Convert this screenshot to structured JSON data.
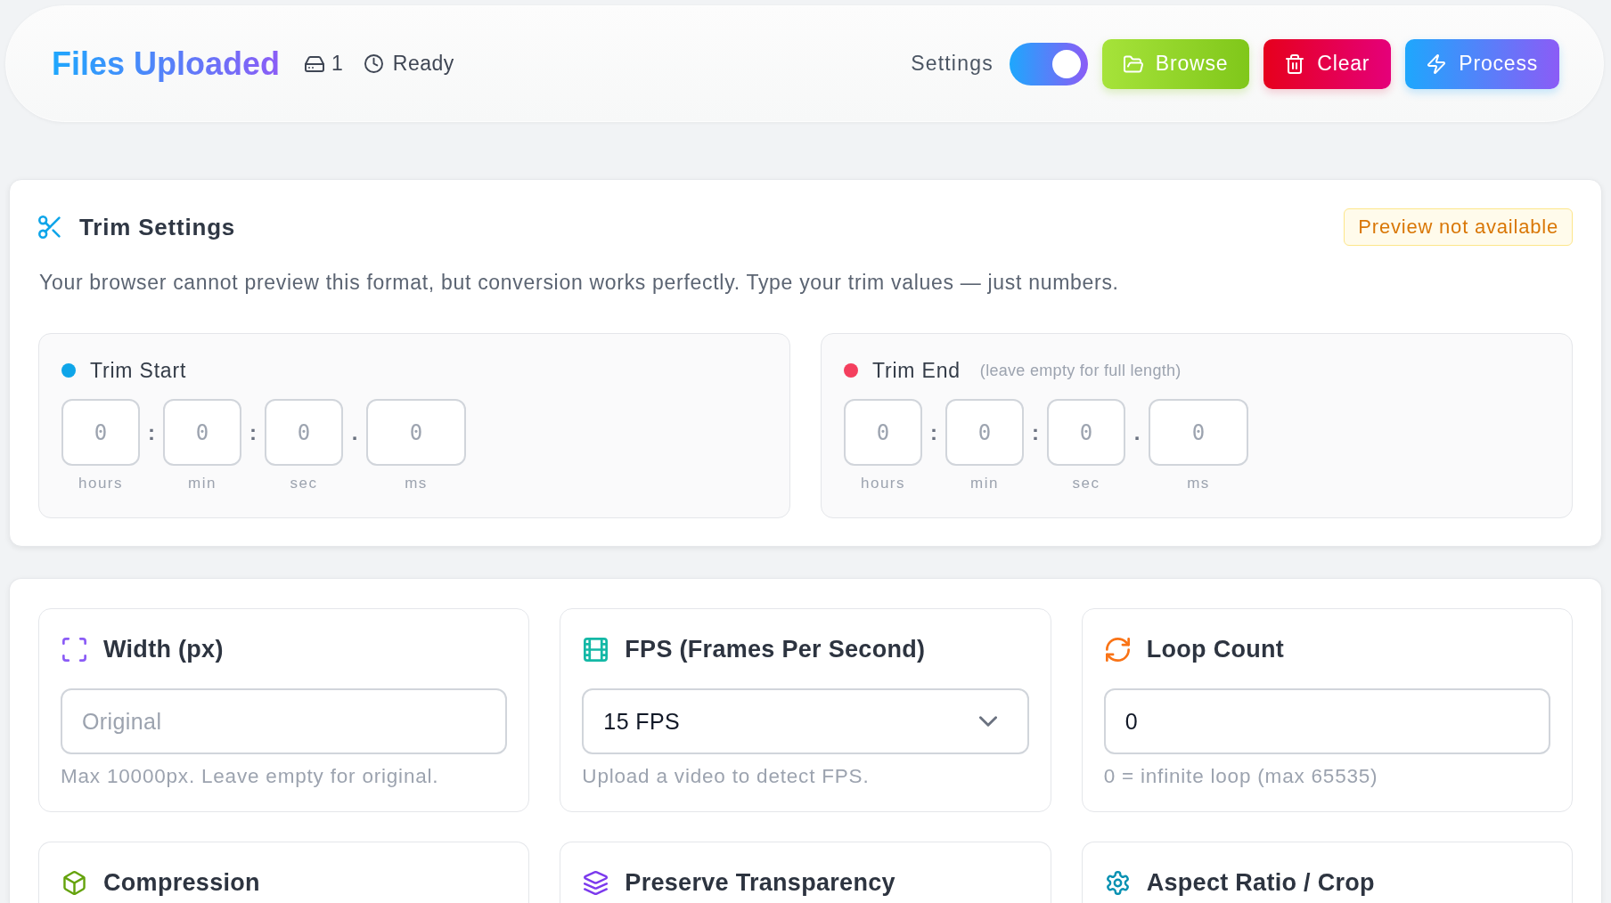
{
  "header": {
    "title": "Files Uploaded",
    "file_count": "1",
    "status": "Ready",
    "settings_label": "Settings",
    "settings_toggle": {
      "on": true
    },
    "buttons": [
      {
        "kind": "browse",
        "label": "Browse"
      },
      {
        "kind": "clear",
        "label": "Clear"
      },
      {
        "kind": "process",
        "label": "Process"
      }
    ]
  },
  "trim_settings": {
    "title": "Trim Settings",
    "badge": "Preview not available",
    "description": "Your browser cannot preview this format, but conversion works perfectly. Type your trim values — just numbers.",
    "panels": [
      {
        "title": "Trim Start",
        "color": "#0ea5e9",
        "fields": [
          {
            "placeholder": "0",
            "unit": "hours",
            "separator": ":"
          },
          {
            "placeholder": "0",
            "unit": "min",
            "separator": ":"
          },
          {
            "placeholder": "0",
            "unit": "sec",
            "separator": "."
          },
          {
            "placeholder": "0",
            "unit": "ms"
          }
        ]
      },
      {
        "title": "Trim End",
        "note": "(leave empty for full length)",
        "color": "#f43f5e",
        "fields": [
          {
            "placeholder": "0",
            "unit": "hours",
            "separator": ":"
          },
          {
            "placeholder": "0",
            "unit": "min",
            "separator": ":"
          },
          {
            "placeholder": "0",
            "unit": "sec",
            "separator": "."
          },
          {
            "placeholder": "0",
            "unit": "ms"
          }
        ]
      }
    ]
  },
  "options": [
    {
      "kind": "input",
      "title": "Width (px)",
      "placeholder": "Original",
      "hint": "Max 10000px. Leave empty for original."
    },
    {
      "kind": "select",
      "title": "FPS (Frames Per Second)",
      "value": "15 FPS",
      "hint": "Upload a video to detect FPS."
    },
    {
      "kind": "input",
      "title": "Loop Count",
      "value": "0",
      "hint": "0 = infinite loop (max 65535)"
    },
    {
      "kind": "heading",
      "title": "Compression"
    },
    {
      "kind": "heading",
      "title": "Preserve Transparency"
    },
    {
      "kind": "heading",
      "title": "Aspect Ratio / Crop"
    }
  ]
}
